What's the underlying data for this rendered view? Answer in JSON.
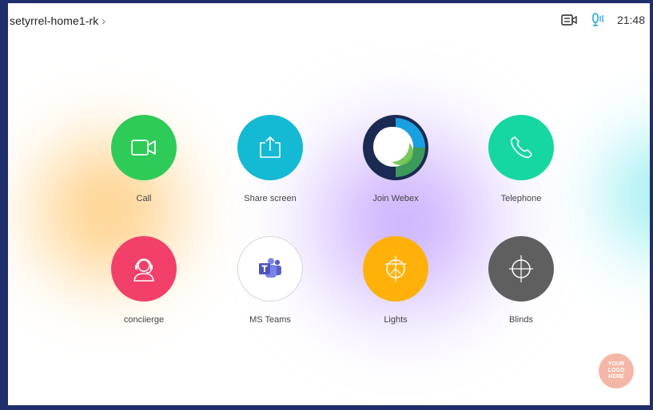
{
  "header": {
    "room_name": "setyrrel-home1-rk",
    "chevron": "›",
    "time": "21:48",
    "icons": [
      "camera-control-icon",
      "microphone-icon"
    ]
  },
  "apps": [
    {
      "label": "Call",
      "icon": "video-camera-icon",
      "color": "#2ecb58"
    },
    {
      "label": "Share screen",
      "icon": "share-upload-icon",
      "color": "#14b9d3"
    },
    {
      "label": "Join Webex",
      "icon": "webex-logo-icon",
      "color": "#ffffff"
    },
    {
      "label": "Telephone",
      "icon": "phone-handset-icon",
      "color": "#16d6a1"
    },
    {
      "label": "conciierge",
      "icon": "headset-agent-icon",
      "color": "#f2406b"
    },
    {
      "label": "MS Teams",
      "icon": "ms-teams-icon",
      "color": "#ffffff"
    },
    {
      "label": "Lights",
      "icon": "lightbulb-icon",
      "color": "#ffb10a"
    },
    {
      "label": "Blinds",
      "icon": "blinds-icon",
      "color": "#5f5f5f"
    }
  ],
  "logo": {
    "lines": [
      "YOUR",
      "LOGO",
      "HERE"
    ],
    "color": "#f4b7a7"
  }
}
